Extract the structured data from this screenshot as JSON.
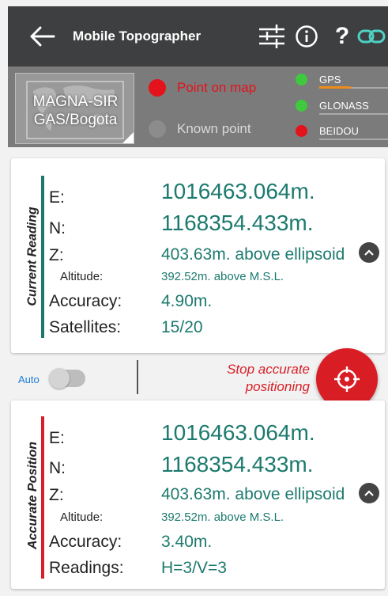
{
  "app": {
    "title": "Mobile Topographer"
  },
  "toolbar": {
    "back_icon": "arrow-left-icon",
    "settings_icon": "sliders-icon",
    "info_icon": "info-circle-icon",
    "help_label": "?",
    "link_icon": "link-icon"
  },
  "status": {
    "crs_line1": "MAGNA-SIR",
    "crs_line2": "GAS/Bogota",
    "mode_map": "Point on map",
    "mode_known": "Known point",
    "gnss": [
      {
        "label": "GPS",
        "color": "#3ec93e",
        "signal": 0.45
      },
      {
        "label": "GLONASS",
        "color": "#3ec93e",
        "signal": 0.0
      },
      {
        "label": "BEIDOU",
        "color": "#e4121b",
        "signal": 0.0
      }
    ]
  },
  "current": {
    "section_label": "Current Reading",
    "accent": "#1d7a6e",
    "e_label": "E:",
    "e_value": "1016463.064m.",
    "n_label": "N:",
    "n_value": "1168354.433m.",
    "z_label": "Z:",
    "z_value": "403.63m. above ellipsoid",
    "alt_label": "Altitude:",
    "alt_value": "392.52m. above M.S.L.",
    "acc_label": "Accuracy:",
    "acc_value": "4.90m.",
    "sat_label": "Satellites:",
    "sat_value": "15/20"
  },
  "controls": {
    "auto_label": "Auto",
    "auto_on": false,
    "stop_line1": "Stop accurate",
    "stop_line2": "positioning",
    "fab_icon": "crosshair-icon"
  },
  "accurate": {
    "section_label": "Accurate Position",
    "accent": "#d61f26",
    "e_label": "E:",
    "e_value": "1016463.064m.",
    "n_label": "N:",
    "n_value": "1168354.433m.",
    "z_label": "Z:",
    "z_value": "403.63m. above ellipsoid",
    "alt_label": "Altitude:",
    "alt_value": "392.52m. above M.S.L.",
    "acc_label": "Accuracy:",
    "acc_value": "3.40m.",
    "read_label": "Readings:",
    "read_value": "H=3/V=3"
  }
}
